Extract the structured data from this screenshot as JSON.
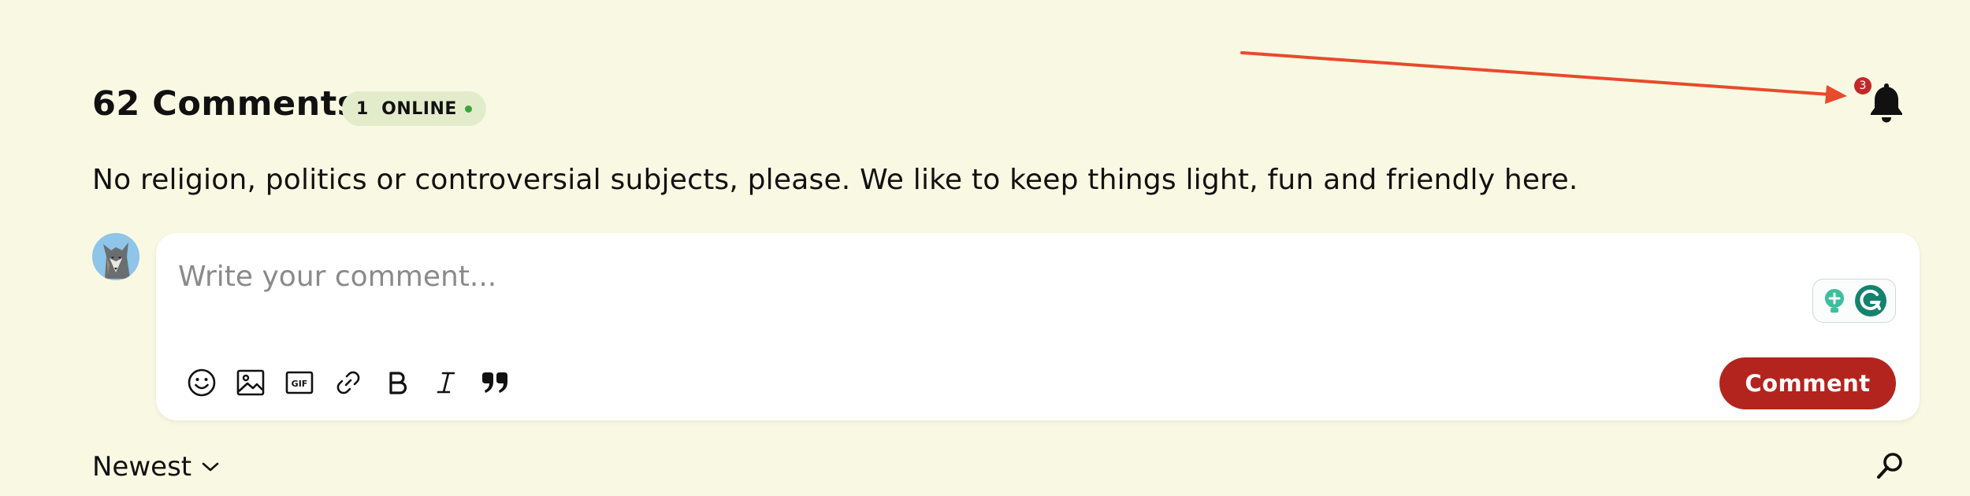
{
  "header": {
    "comment_count_label": "62 Comments",
    "online_label": "1  ONLINE",
    "online_dot_color": "#3aa63a"
  },
  "guidelines": "No religion, politics or controversial subjects, please. We like to keep things light, fun and friendly here.",
  "notifications": {
    "badge_count": "3",
    "icon": "bell-icon",
    "badge_color": "#c2282a"
  },
  "annotation": {
    "arrow_color": "#e84a2c"
  },
  "editor": {
    "placeholder": "Write your comment...",
    "value": "",
    "toolbar": [
      "emoji-icon",
      "image-icon",
      "gif-icon",
      "link-icon",
      "bold-icon",
      "italic-icon",
      "quote-icon"
    ],
    "gif_label": "GIF",
    "submit_label": "Comment",
    "submit_color": "#b3241e"
  },
  "sort": {
    "selected": "Newest"
  },
  "colors": {
    "background": "#f9f9e3",
    "pill_background": "#e2eccb"
  }
}
